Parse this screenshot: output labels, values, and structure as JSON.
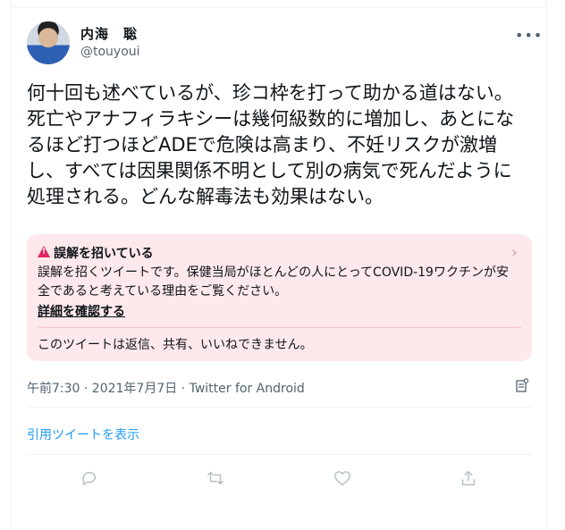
{
  "user": {
    "name": "内海　聡",
    "handle": "@touyoui"
  },
  "tweet": {
    "text": "何十回も述べているが、珍コ枠を打って助かる道はない。死亡やアナフィラキシーは幾何級数的に増加し、あとになるほど打つほどADEで危険は高まり、不妊リスクが激増し、すべては因果関係不明として別の病気で死んだように処理される。どんな解毒法も効果はない。"
  },
  "notice": {
    "title": "誤解を招いている",
    "body": "誤解を招くツイートです。保健当局がほとんどの人にとってCOVID-19ワクチンが安全であると考えている理由をご覧ください。",
    "link": "詳細を確認する",
    "footer": "このツイートは返信、共有、いいねできません。",
    "accent_color": "#e0245e",
    "background_color": "#fde8ec"
  },
  "meta": {
    "timestamp": "午前7:30 · 2021年7月7日 · Twitter for Android"
  },
  "quote_tweets_link": "引用ツイートを表示",
  "icons": {
    "more": "more-dots-icon",
    "warning": "warning-triangle-icon",
    "chevron": "chevron-right-icon",
    "analytics": "analytics-icon",
    "reply": "reply-icon",
    "retweet": "retweet-icon",
    "like": "like-icon",
    "share": "share-icon"
  },
  "colors": {
    "link": "#1d9bf0",
    "secondary_text": "#536471"
  }
}
